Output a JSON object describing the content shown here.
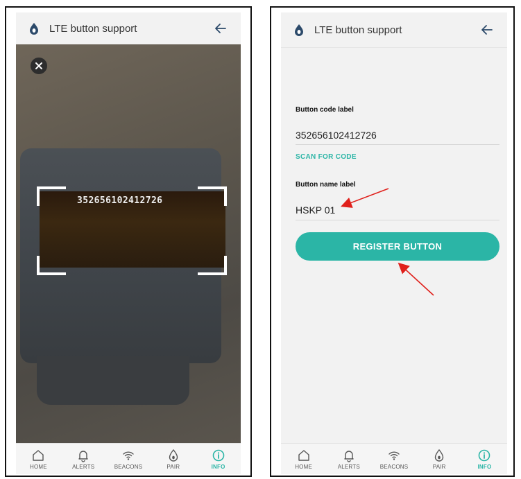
{
  "left_screen": {
    "header": {
      "title": "LTE button support",
      "logo_icon": "drop-logo-icon",
      "back_icon": "arrow-left-icon"
    },
    "camera": {
      "close_icon": "close-icon",
      "scanned_code": "352656102412726"
    }
  },
  "right_screen": {
    "header": {
      "title": "LTE button support",
      "logo_icon": "drop-logo-icon",
      "back_icon": "arrow-left-icon"
    },
    "form": {
      "code_label": "Button code label",
      "code_value": "352656102412726",
      "scan_link": "SCAN FOR CODE",
      "name_label": "Button name label",
      "name_value": "HSKP 01",
      "register_button": "REGISTER BUTTON"
    }
  },
  "nav": {
    "items": [
      {
        "label": "HOME",
        "icon": "home-icon"
      },
      {
        "label": "ALERTS",
        "icon": "bell-icon"
      },
      {
        "label": "BEACONS",
        "icon": "wifi-icon"
      },
      {
        "label": "PAIR",
        "icon": "drop-icon"
      },
      {
        "label": "INFO",
        "icon": "info-icon"
      }
    ],
    "active": "INFO"
  },
  "colors": {
    "accent": "#2bb5a6",
    "annotation_arrow": "#e0201b",
    "header_bg": "#f2f2f2"
  }
}
